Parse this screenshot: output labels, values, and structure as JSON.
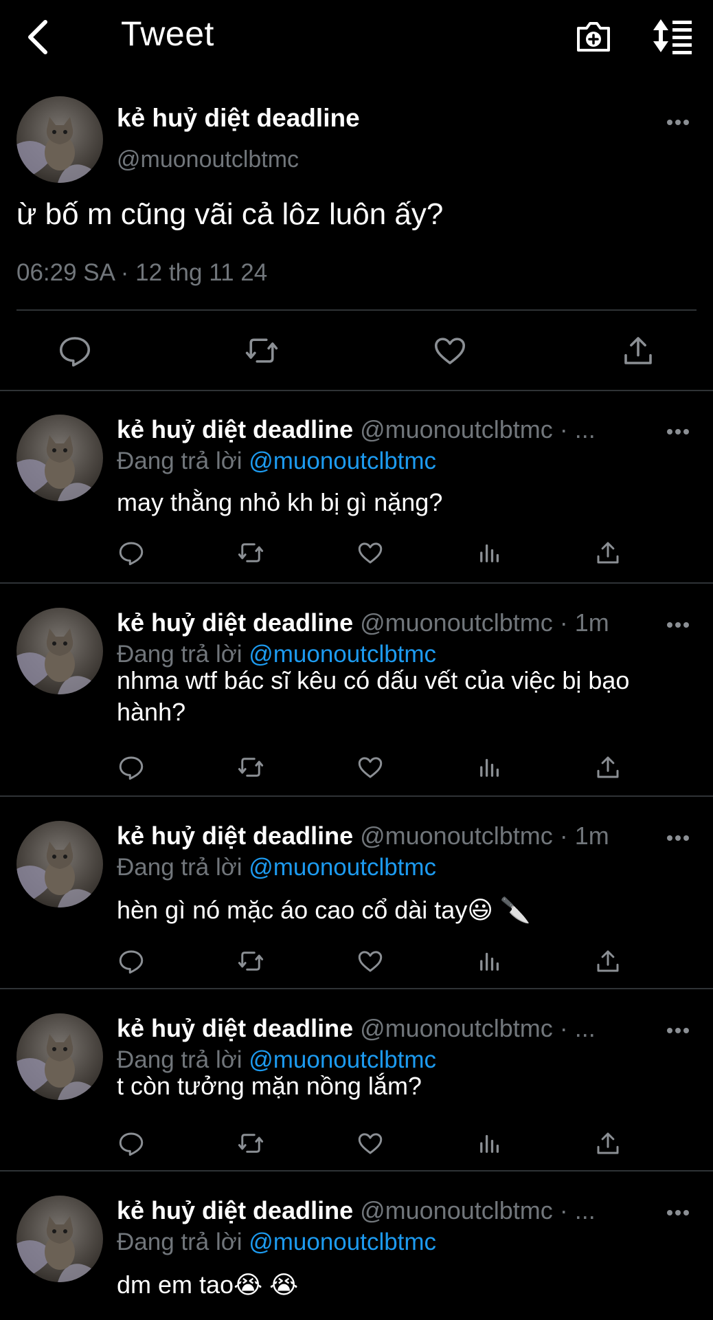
{
  "header": {
    "title": "Tweet",
    "back_icon": "chevron-left-icon",
    "camera_icon": "camera-plus-icon",
    "sort_icon": "sort-list-icon"
  },
  "main_tweet": {
    "display_name": "kẻ huỷ diệt deadline",
    "handle": "@muonoutclbtmc",
    "text": "ừ bố m cũng vãi cả lôz luôn ấy?",
    "meta": "06:29 SA · 12 thg 11 24"
  },
  "replies": [
    {
      "display_name": "kẻ huỷ diệt deadline",
      "handle": "@muonoutclbtmc",
      "time": "· ...",
      "replying_label": "Đang trả lời",
      "replying_to": "@muonoutclbtmc",
      "text": "may thằng nhỏ kh bị gì nặng?"
    },
    {
      "display_name": "kẻ huỷ diệt deadline",
      "handle": "@muonoutclbtmc",
      "time": "· 1m",
      "replying_label": "Đang trả lời",
      "replying_to": "@muonoutclbtmc",
      "text": "nhma wtf bác sĩ kêu có dấu vết của việc bị bạo hành?"
    },
    {
      "display_name": "kẻ huỷ diệt deadline",
      "handle": "@muonoutclbtmc",
      "time": "· 1m",
      "replying_label": "Đang trả lời",
      "replying_to": "@muonoutclbtmc",
      "text": "hèn gì nó mặc áo cao cổ dài tay😃 🔪"
    },
    {
      "display_name": "kẻ huỷ diệt deadline",
      "handle": "@muonoutclbtmc",
      "time": "· ...",
      "replying_label": "Đang trả lời",
      "replying_to": "@muonoutclbtmc",
      "text": "t còn tưởng mặn nồng lắm?"
    },
    {
      "display_name": "kẻ huỷ diệt deadline",
      "handle": "@muonoutclbtmc",
      "time": "· ...",
      "replying_label": "Đang trả lời",
      "replying_to": "@muonoutclbtmc",
      "text": "dm em tao😭 😭"
    }
  ],
  "colors": {
    "background": "#000000",
    "text": "#ffffff",
    "muted": "#71767b",
    "accent": "#1d9bf0",
    "divider": "#2f3336"
  }
}
